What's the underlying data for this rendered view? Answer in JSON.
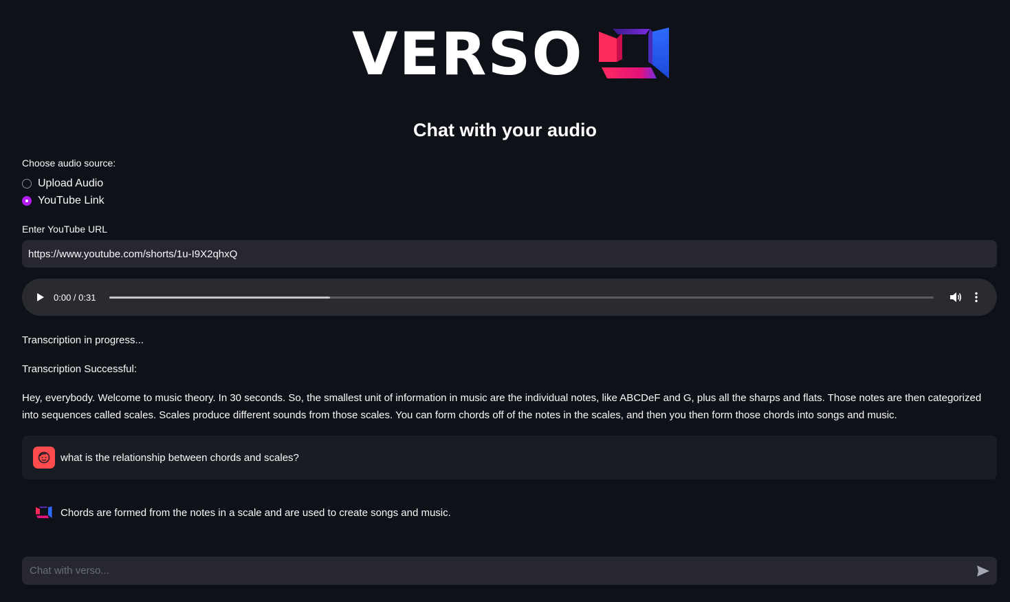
{
  "logo": {
    "text": "VERSO",
    "colors": {
      "red": "#ff2a5c",
      "magenta": "#e3127b",
      "blue": "#1f63ff",
      "purple": "#7b2ae0"
    }
  },
  "title": "Chat with your audio",
  "audio_source": {
    "label": "Choose audio source:",
    "options": [
      {
        "label": "Upload Audio",
        "selected": false
      },
      {
        "label": "YouTube Link",
        "selected": true
      }
    ],
    "accent_color": "#b21cf0"
  },
  "youtube": {
    "label": "Enter YouTube URL",
    "value": "https://www.youtube.com/shorts/1u-I9X2qhxQ"
  },
  "player": {
    "time": "0:00 / 0:31",
    "buffered_fraction": 0.268,
    "icons": {
      "play": "play-icon",
      "volume": "volume-icon",
      "more": "more-vertical-icon"
    }
  },
  "status": {
    "progress": "Transcription in progress...",
    "success": "Transcription Successful:"
  },
  "transcript": "Hey, everybody. Welcome to music theory. In 30 seconds. So, the smallest unit of information in music are the individual notes, like ABCDeF and G, plus all the sharps and flats. Those notes are then categorized into sequences called scales. Scales produce different sounds from those scales. You can form chords off of the notes in the scales, and then you then form those chords into songs and music.",
  "chat": {
    "messages": [
      {
        "role": "user",
        "avatar": "user-face-icon",
        "avatar_color": "#ff4b4b",
        "text": "what is the relationship between chords and scales?"
      },
      {
        "role": "assistant",
        "avatar": "verso-logo-icon",
        "text": "Chords are formed from the notes in a scale and are used to create songs and music."
      }
    ],
    "input_placeholder": "Chat with verso...",
    "send_icon": "send-icon"
  }
}
